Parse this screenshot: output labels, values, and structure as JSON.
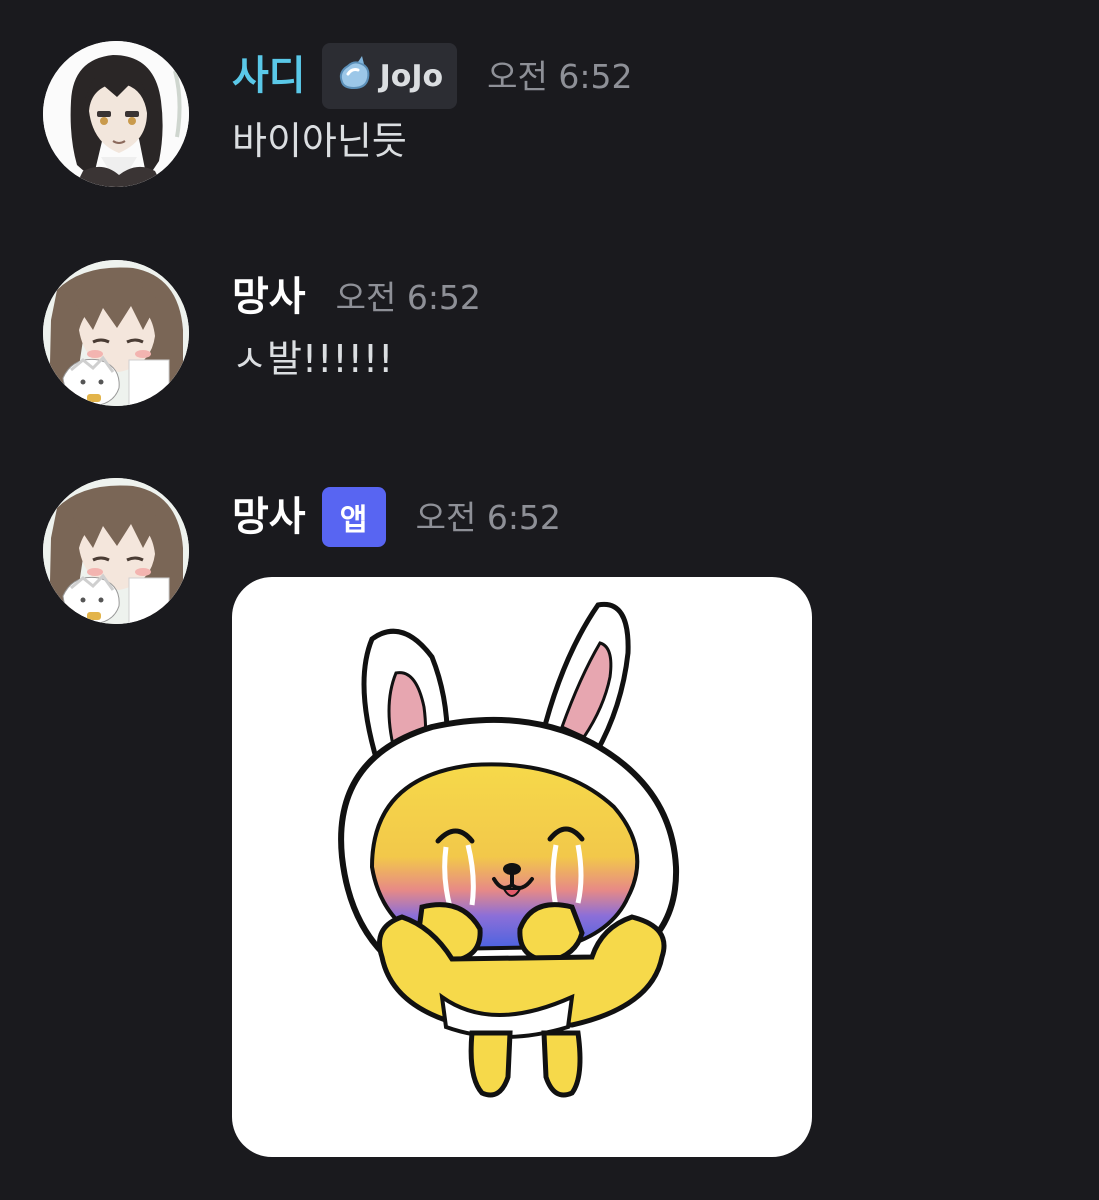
{
  "messages": [
    {
      "username": "사디",
      "username_color": "#5ac8e8",
      "badge_icon": "water-drop-icon",
      "badge_label": "JoJo",
      "timestamp": "오전 6:52",
      "text": "바이아닌듯"
    },
    {
      "username": "망사",
      "username_color": "#ffffff",
      "timestamp": "오전 6:52",
      "text": "ㅅ발!!!!!!"
    },
    {
      "username": "망사",
      "username_color": "#ffffff",
      "app_badge": "앱",
      "app_badge_color": "#5865f2",
      "timestamp": "오전 6:52",
      "sticker_icon": "crying-bunny-sticker-icon"
    }
  ]
}
